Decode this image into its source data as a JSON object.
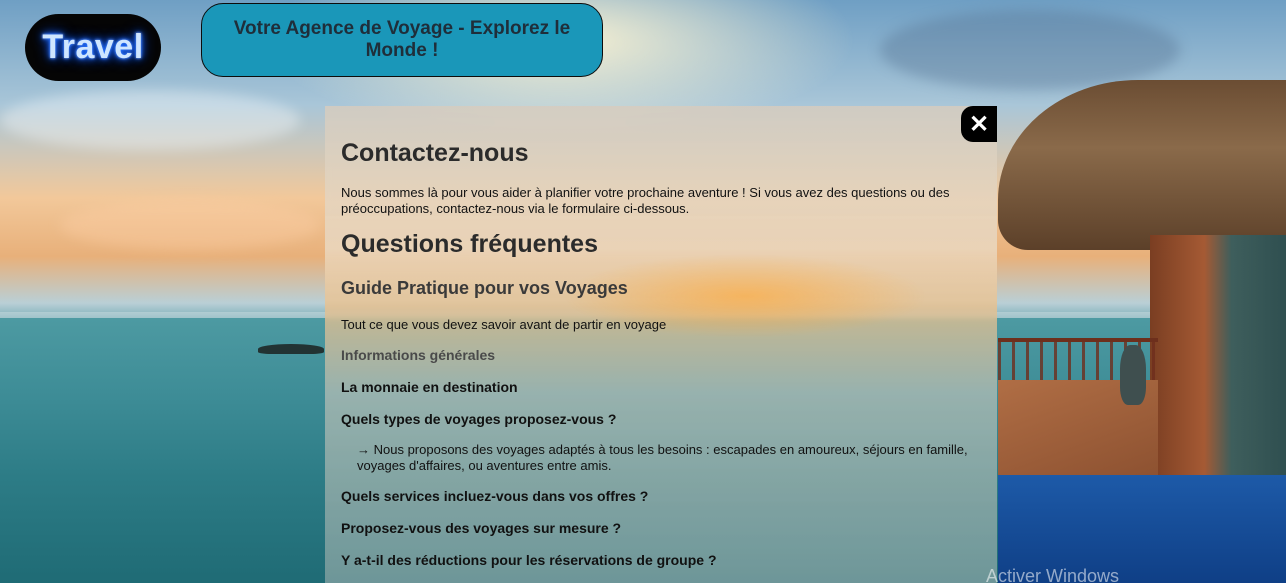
{
  "header": {
    "logo_text": "Travel",
    "tagline": "Votre Agence de Voyage - Explorez le Monde !"
  },
  "modal": {
    "close_label": "✕",
    "contact_title": "Contactez-nous",
    "contact_text": "Nous sommes là pour vous aider à planifier votre prochaine aventure ! Si vous avez des questions ou des préoccupations, contactez-nous via le formulaire ci-dessous.",
    "faq_title": "Questions fréquentes",
    "guide_title": "Guide Pratique pour vos Voyages",
    "guide_text": "Tout ce que vous devez savoir avant de partir en voyage",
    "info_title": "Informations générales",
    "questions": [
      "La monnaie en destination",
      "Quels types de voyages proposez-vous ?",
      "Quels services incluez-vous dans vos offres ?",
      "Proposez-vous des voyages sur mesure ?",
      "Y a-t-il des réductions pour les réservations de groupe ?"
    ],
    "answer_2": "→ Nous proposons des voyages adaptés à tous les besoins : escapades en amoureux, séjours en famille, voyages d'affaires, ou aventures entre amis."
  },
  "watermark": "Activer Windows",
  "colors": {
    "title_box": "#1a97b9",
    "logo_bg": "#050505",
    "logo_glow": "#1e6cff"
  }
}
